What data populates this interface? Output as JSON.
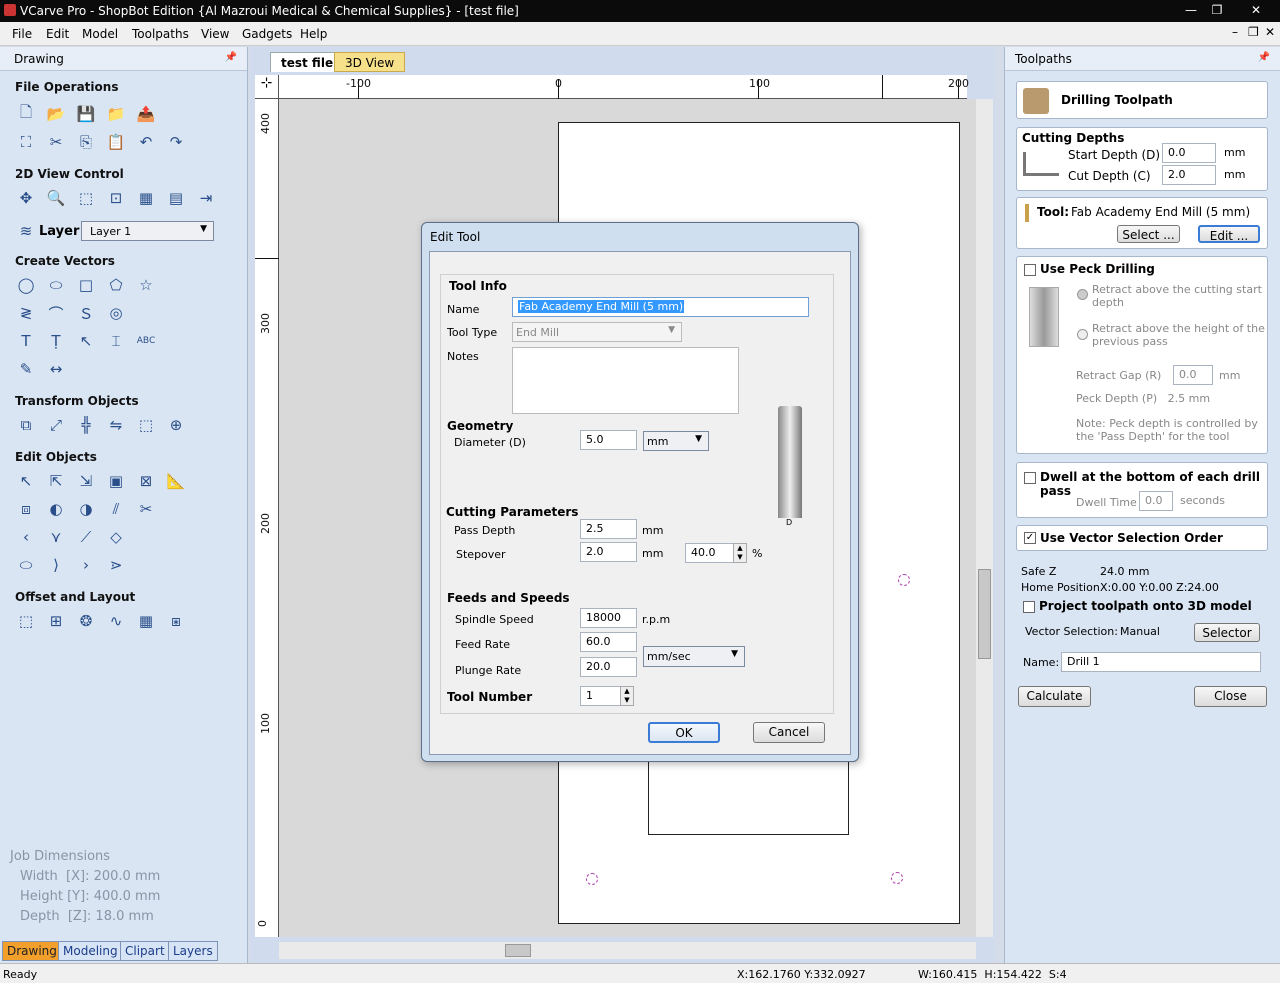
{
  "window": {
    "title": "VCarve Pro - ShopBot Edition {Al Mazroui Medical & Chemical Supplies} - [test file]"
  },
  "menu": [
    "File",
    "Edit",
    "Model",
    "Toolpaths",
    "View",
    "Gadgets",
    "Help"
  ],
  "left_panel": {
    "title": "Drawing",
    "sections": {
      "file_ops": "File Operations",
      "view_control": "2D View Control",
      "create_vectors": "Create Vectors",
      "transform": "Transform Objects",
      "edit_objects": "Edit Objects",
      "offset_layout": "Offset and Layout"
    },
    "layer_label": "Layer",
    "layer_value": "Layer 1",
    "job": {
      "title": "Job Dimensions",
      "width": "Width  [X]: 200.0 mm",
      "height": "Height [Y]: 400.0 mm",
      "depth": "Depth  [Z]: 18.0 mm"
    },
    "tabs": [
      "Drawing",
      "Modeling",
      "Clipart",
      "Layers"
    ]
  },
  "center": {
    "tabs": [
      "test file",
      "3D View"
    ],
    "ruler_top": [
      "-100",
      "0",
      "100",
      "200"
    ],
    "ruler_left": [
      "400",
      "300",
      "200",
      "100",
      "0"
    ]
  },
  "dialog": {
    "title": "Edit Tool",
    "tool_info": "Tool Info",
    "name_label": "Name",
    "name_value": "Fab Academy End Mill (5 mm)",
    "type_label": "Tool Type",
    "type_value": "End Mill",
    "notes_label": "Notes",
    "geometry": "Geometry",
    "diameter_label": "Diameter (D)",
    "diameter_value": "5.0",
    "unit": "mm",
    "cutting": "Cutting Parameters",
    "pass_depth_label": "Pass Depth",
    "pass_depth_value": "2.5",
    "pass_unit": "mm",
    "stepover_label": "Stepover",
    "stepover_value": "2.0",
    "stepover_unit": "mm",
    "stepover_pct": "40.0",
    "pct": "%",
    "feeds": "Feeds and Speeds",
    "spindle_label": "Spindle Speed",
    "spindle_value": "18000",
    "rpm": "r.p.m",
    "feed_label": "Feed Rate",
    "feed_value": "60.0",
    "plunge_label": "Plunge Rate",
    "plunge_value": "20.0",
    "rate_unit": "mm/sec",
    "toolnum_label": "Tool Number",
    "toolnum_value": "1",
    "ok": "OK",
    "cancel": "Cancel",
    "diagram_label": "D"
  },
  "right_panel": {
    "title": "Toolpaths",
    "header": "Drilling Toolpath",
    "cutting_depths": "Cutting Depths",
    "start_label": "Start Depth (D)",
    "start_value": "0.0",
    "cut_label": "Cut Depth (C)",
    "cut_value": "2.0",
    "mm": "mm",
    "tool_label": "Tool:",
    "tool_value": "Fab Academy End Mill (5 mm)",
    "select": "Select ...",
    "edit": "Edit ...",
    "peck": "Use Peck Drilling",
    "retract1": "Retract above the cutting start depth",
    "retract2": "Retract above the height of the previous pass",
    "retract_gap_label": "Retract Gap (R)",
    "retract_gap_value": "0.0",
    "peck_depth": "Peck Depth (P)   2.5 mm",
    "peck_note": "Note: Peck depth is controlled by the 'Pass Depth' for the tool",
    "dwell": "Dwell at the bottom of each drill pass",
    "dwell_label": "Dwell Time",
    "dwell_value": "0.0",
    "seconds": "seconds",
    "vector_order": "Use Vector Selection Order",
    "safe_z_label": "Safe Z",
    "safe_z_value": "24.0 mm",
    "home_label": "Home Position",
    "home_value": "X:0.00 Y:0.00 Z:24.00",
    "project": "Project toolpath onto 3D model",
    "vecsel_label": "Vector Selection:",
    "vecsel_value": "Manual",
    "selector": "Selector ...",
    "name_label": "Name:",
    "name_value": "Drill 1",
    "calculate": "Calculate",
    "close": "Close"
  },
  "status": {
    "ready": "Ready",
    "coords": "X:162.1760 Y:332.0927",
    "size": "W:160.415  H:154.422  S:4"
  }
}
